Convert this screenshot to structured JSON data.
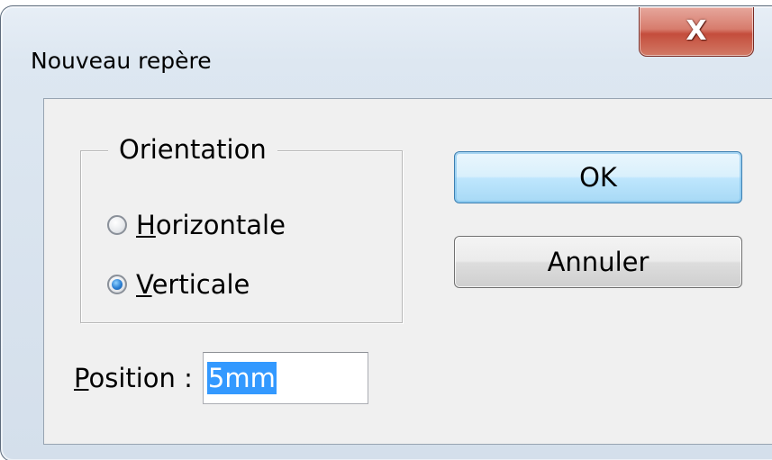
{
  "window": {
    "title": "Nouveau repère",
    "close_glyph": "X",
    "close_icon": "close-icon"
  },
  "orientation": {
    "legend": "Orientation",
    "options": [
      {
        "label": "Horizontale",
        "mnemonic": "H",
        "rest": "orizontale",
        "checked": false
      },
      {
        "label": "Verticale",
        "mnemonic": "V",
        "rest": "erticale",
        "checked": true
      }
    ]
  },
  "buttons": {
    "ok_label": "OK",
    "cancel_label": "Annuler"
  },
  "position": {
    "label_mnemonic": "P",
    "label_rest": "osition :",
    "value": "5mm"
  },
  "colors": {
    "selection": "#3399ff",
    "default_button_border": "#3c7fb1",
    "close_button": "#c44d3c"
  }
}
